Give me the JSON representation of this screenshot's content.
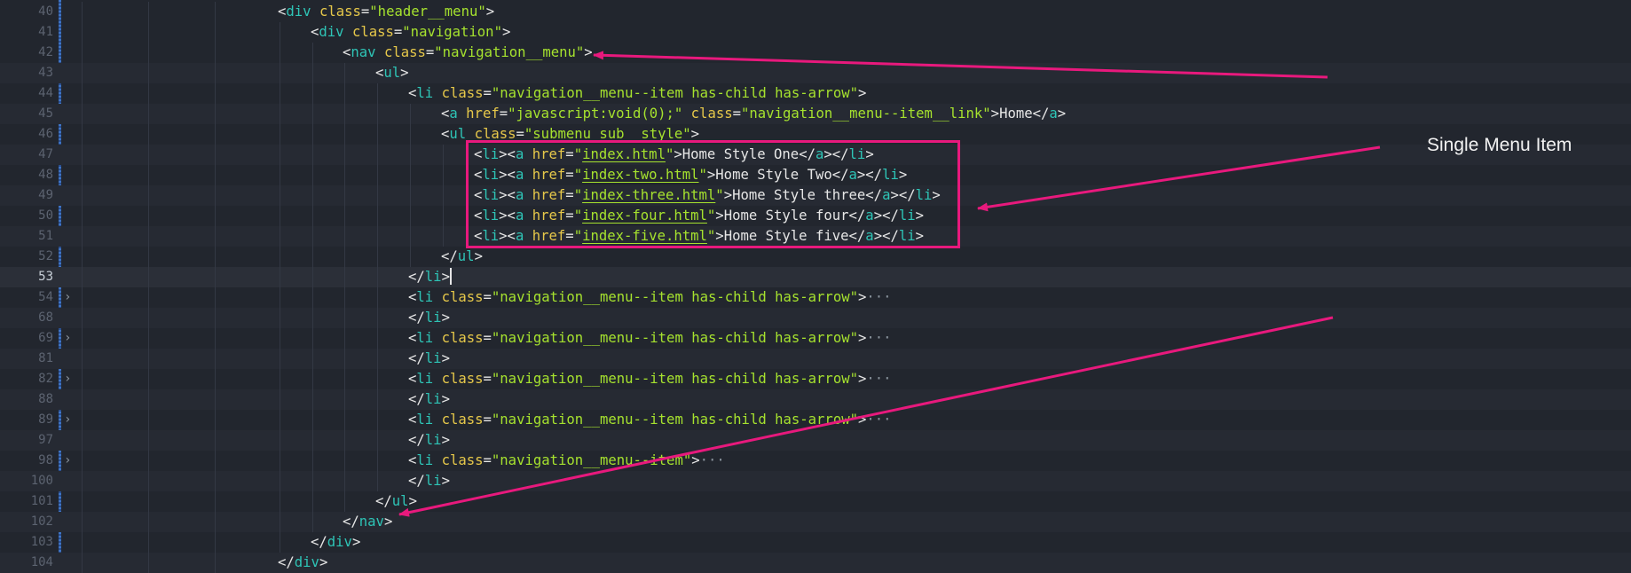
{
  "editor": {
    "lines": [
      {
        "num": "40",
        "tokens": [
          [
            "p",
            "<"
          ],
          [
            "tag",
            "div"
          ],
          [
            "p",
            " "
          ],
          [
            "attr",
            "class"
          ],
          [
            "eq",
            "="
          ],
          [
            "str",
            "\"header__menu\""
          ],
          [
            "p",
            ">"
          ]
        ]
      },
      {
        "num": "41",
        "tokens": [
          [
            "p",
            "<"
          ],
          [
            "tag",
            "div"
          ],
          [
            "p",
            " "
          ],
          [
            "attr",
            "class"
          ],
          [
            "eq",
            "="
          ],
          [
            "str",
            "\"navigation\""
          ],
          [
            "p",
            ">"
          ]
        ]
      },
      {
        "num": "42",
        "tokens": [
          [
            "p",
            "<"
          ],
          [
            "tag",
            "nav"
          ],
          [
            "p",
            " "
          ],
          [
            "attr",
            "class"
          ],
          [
            "eq",
            "="
          ],
          [
            "str",
            "\"navigation__menu\""
          ],
          [
            "p",
            ">"
          ]
        ]
      },
      {
        "num": "43",
        "tokens": [
          [
            "p",
            "<"
          ],
          [
            "tag",
            "ul"
          ],
          [
            "p",
            ">"
          ]
        ]
      },
      {
        "num": "44",
        "tokens": [
          [
            "p",
            "<"
          ],
          [
            "tag",
            "li"
          ],
          [
            "p",
            " "
          ],
          [
            "attr",
            "class"
          ],
          [
            "eq",
            "="
          ],
          [
            "str",
            "\"navigation__menu--item has-child has-arrow\""
          ],
          [
            "p",
            ">"
          ]
        ]
      },
      {
        "num": "45",
        "tokens": [
          [
            "p",
            "<"
          ],
          [
            "tag",
            "a"
          ],
          [
            "p",
            " "
          ],
          [
            "attr",
            "href"
          ],
          [
            "eq",
            "="
          ],
          [
            "str",
            "\"javascript:void(0);\""
          ],
          [
            "p",
            " "
          ],
          [
            "attr",
            "class"
          ],
          [
            "eq",
            "="
          ],
          [
            "str",
            "\"navigation__menu--item__link\""
          ],
          [
            "p",
            ">"
          ],
          [
            "text",
            "Home"
          ],
          [
            "p",
            "</"
          ],
          [
            "tag",
            "a"
          ],
          [
            "p",
            ">"
          ]
        ]
      },
      {
        "num": "46",
        "tokens": [
          [
            "p",
            "<"
          ],
          [
            "tag",
            "ul"
          ],
          [
            "p",
            " "
          ],
          [
            "attr",
            "class"
          ],
          [
            "eq",
            "="
          ],
          [
            "str",
            "\"submenu sub__style\""
          ],
          [
            "p",
            ">"
          ]
        ]
      },
      {
        "num": "47",
        "tokens": [
          [
            "p",
            "<"
          ],
          [
            "tag",
            "li"
          ],
          [
            "p",
            "><"
          ],
          [
            "tag",
            "a"
          ],
          [
            "p",
            " "
          ],
          [
            "attr",
            "href"
          ],
          [
            "eq",
            "="
          ],
          [
            "str",
            "\""
          ],
          [
            "link",
            "index.html"
          ],
          [
            "str",
            "\""
          ],
          [
            "p",
            ">"
          ],
          [
            "text",
            "Home Style One"
          ],
          [
            "p",
            "</"
          ],
          [
            "tag",
            "a"
          ],
          [
            "p",
            "></"
          ],
          [
            "tag",
            "li"
          ],
          [
            "p",
            ">"
          ]
        ]
      },
      {
        "num": "48",
        "tokens": [
          [
            "p",
            "<"
          ],
          [
            "tag",
            "li"
          ],
          [
            "p",
            "><"
          ],
          [
            "tag",
            "a"
          ],
          [
            "p",
            " "
          ],
          [
            "attr",
            "href"
          ],
          [
            "eq",
            "="
          ],
          [
            "str",
            "\""
          ],
          [
            "link",
            "index-two.html"
          ],
          [
            "str",
            "\""
          ],
          [
            "p",
            ">"
          ],
          [
            "text",
            "Home Style Two"
          ],
          [
            "p",
            "</"
          ],
          [
            "tag",
            "a"
          ],
          [
            "p",
            "></"
          ],
          [
            "tag",
            "li"
          ],
          [
            "p",
            ">"
          ]
        ]
      },
      {
        "num": "49",
        "tokens": [
          [
            "p",
            "<"
          ],
          [
            "tag",
            "li"
          ],
          [
            "p",
            "><"
          ],
          [
            "tag",
            "a"
          ],
          [
            "p",
            " "
          ],
          [
            "attr",
            "href"
          ],
          [
            "eq",
            "="
          ],
          [
            "str",
            "\""
          ],
          [
            "link",
            "index-three.html"
          ],
          [
            "str",
            "\""
          ],
          [
            "p",
            ">"
          ],
          [
            "text",
            "Home Style three"
          ],
          [
            "p",
            "</"
          ],
          [
            "tag",
            "a"
          ],
          [
            "p",
            "></"
          ],
          [
            "tag",
            "li"
          ],
          [
            "p",
            ">"
          ]
        ]
      },
      {
        "num": "50",
        "tokens": [
          [
            "p",
            "<"
          ],
          [
            "tag",
            "li"
          ],
          [
            "p",
            "><"
          ],
          [
            "tag",
            "a"
          ],
          [
            "p",
            " "
          ],
          [
            "attr",
            "href"
          ],
          [
            "eq",
            "="
          ],
          [
            "str",
            "\""
          ],
          [
            "link",
            "index-four.html"
          ],
          [
            "str",
            "\""
          ],
          [
            "p",
            ">"
          ],
          [
            "text",
            "Home Style four"
          ],
          [
            "p",
            "</"
          ],
          [
            "tag",
            "a"
          ],
          [
            "p",
            "></"
          ],
          [
            "tag",
            "li"
          ],
          [
            "p",
            ">"
          ]
        ]
      },
      {
        "num": "51",
        "tokens": [
          [
            "p",
            "<"
          ],
          [
            "tag",
            "li"
          ],
          [
            "p",
            "><"
          ],
          [
            "tag",
            "a"
          ],
          [
            "p",
            " "
          ],
          [
            "attr",
            "href"
          ],
          [
            "eq",
            "="
          ],
          [
            "str",
            "\""
          ],
          [
            "link",
            "index-five.html"
          ],
          [
            "str",
            "\""
          ],
          [
            "p",
            ">"
          ],
          [
            "text",
            "Home Style five"
          ],
          [
            "p",
            "</"
          ],
          [
            "tag",
            "a"
          ],
          [
            "p",
            "></"
          ],
          [
            "tag",
            "li"
          ],
          [
            "p",
            ">"
          ]
        ]
      },
      {
        "num": "52",
        "tokens": [
          [
            "p",
            "</"
          ],
          [
            "tag",
            "ul"
          ],
          [
            "p",
            ">"
          ]
        ]
      },
      {
        "num": "53",
        "current": true,
        "tokens": [
          [
            "p",
            "</"
          ],
          [
            "tag",
            "li"
          ],
          [
            "p",
            ">"
          ]
        ]
      },
      {
        "num": "54",
        "fold": true,
        "tokens": [
          [
            "p",
            "<"
          ],
          [
            "tag",
            "li"
          ],
          [
            "p",
            " "
          ],
          [
            "attr",
            "class"
          ],
          [
            "eq",
            "="
          ],
          [
            "str",
            "\"navigation__menu--item has-child has-arrow\""
          ],
          [
            "p",
            ">"
          ],
          [
            "ell",
            "···"
          ]
        ]
      },
      {
        "num": "68",
        "tokens": [
          [
            "p",
            "</"
          ],
          [
            "tag",
            "li"
          ],
          [
            "p",
            ">"
          ]
        ]
      },
      {
        "num": "69",
        "fold": true,
        "tokens": [
          [
            "p",
            "<"
          ],
          [
            "tag",
            "li"
          ],
          [
            "p",
            " "
          ],
          [
            "attr",
            "class"
          ],
          [
            "eq",
            "="
          ],
          [
            "str",
            "\"navigation__menu--item has-child has-arrow\""
          ],
          [
            "p",
            ">"
          ],
          [
            "ell",
            "···"
          ]
        ]
      },
      {
        "num": "81",
        "tokens": [
          [
            "p",
            "</"
          ],
          [
            "tag",
            "li"
          ],
          [
            "p",
            ">"
          ]
        ]
      },
      {
        "num": "82",
        "fold": true,
        "tokens": [
          [
            "p",
            "<"
          ],
          [
            "tag",
            "li"
          ],
          [
            "p",
            " "
          ],
          [
            "attr",
            "class"
          ],
          [
            "eq",
            "="
          ],
          [
            "str",
            "\"navigation__menu--item has-child has-arrow\""
          ],
          [
            "p",
            ">"
          ],
          [
            "ell",
            "···"
          ]
        ]
      },
      {
        "num": "88",
        "tokens": [
          [
            "p",
            "</"
          ],
          [
            "tag",
            "li"
          ],
          [
            "p",
            ">"
          ]
        ]
      },
      {
        "num": "89",
        "fold": true,
        "tokens": [
          [
            "p",
            "<"
          ],
          [
            "tag",
            "li"
          ],
          [
            "p",
            " "
          ],
          [
            "attr",
            "class"
          ],
          [
            "eq",
            "="
          ],
          [
            "str",
            "\"navigation__menu--item has-child has-arrow\""
          ],
          [
            "p",
            ">"
          ],
          [
            "ell",
            "···"
          ]
        ]
      },
      {
        "num": "97",
        "tokens": [
          [
            "p",
            "</"
          ],
          [
            "tag",
            "li"
          ],
          [
            "p",
            ">"
          ]
        ]
      },
      {
        "num": "98",
        "fold": true,
        "tokens": [
          [
            "p",
            "<"
          ],
          [
            "tag",
            "li"
          ],
          [
            "p",
            " "
          ],
          [
            "attr",
            "class"
          ],
          [
            "eq",
            "="
          ],
          [
            "str",
            "\"navigation__menu--item\""
          ],
          [
            "p",
            ">"
          ],
          [
            "ell",
            "···"
          ]
        ]
      },
      {
        "num": "100",
        "tokens": [
          [
            "p",
            "</"
          ],
          [
            "tag",
            "li"
          ],
          [
            "p",
            ">"
          ]
        ]
      },
      {
        "num": "101",
        "tokens": [
          [
            "p",
            "</"
          ],
          [
            "tag",
            "ul"
          ],
          [
            "p",
            ">"
          ]
        ]
      },
      {
        "num": "102",
        "tokens": [
          [
            "p",
            "</"
          ],
          [
            "tag",
            "nav"
          ],
          [
            "p",
            ">"
          ]
        ]
      },
      {
        "num": "103",
        "tokens": [
          [
            "p",
            "</"
          ],
          [
            "tag",
            "div"
          ],
          [
            "p",
            ">"
          ]
        ]
      },
      {
        "num": "104",
        "tokens": [
          [
            "p",
            "</"
          ],
          [
            "tag",
            "div"
          ],
          [
            "p",
            ">"
          ]
        ]
      }
    ]
  },
  "annotation": {
    "label": "Single Menu Item",
    "color": "#e8197d"
  },
  "colors": {
    "background": "#22262e",
    "tag": "#2ec4b6",
    "attribute": "#e6c84a",
    "string": "#a6e22e",
    "text": "#e6e6e6",
    "line_number": "#5c6370"
  }
}
